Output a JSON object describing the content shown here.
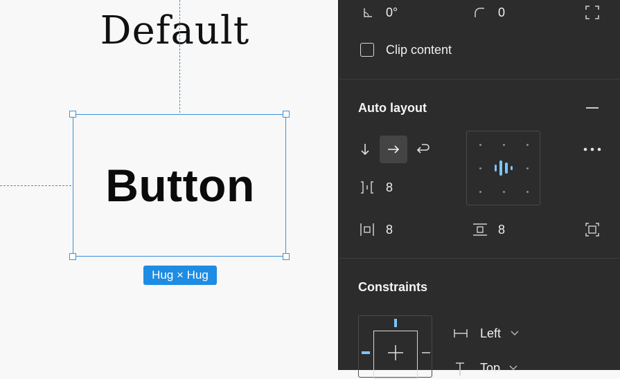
{
  "canvas": {
    "frame_title": "Default",
    "button_label": "Button",
    "size_badge": "Hug × Hug"
  },
  "panel": {
    "rotation": {
      "icon": "rotation-angle-icon",
      "value": "0°"
    },
    "corner_radius": {
      "icon": "corner-radius-icon",
      "value": "0"
    },
    "independent_corners_icon": "independent-corners-icon",
    "clip_content": {
      "label": "Clip content",
      "checked": false
    },
    "auto_layout": {
      "title": "Auto layout",
      "remove_icon": "minus-icon",
      "directions": [
        "down-arrow",
        "right-arrow",
        "wrap-arrow"
      ],
      "active_direction": "right-arrow",
      "gap": "8",
      "horizontal_padding": "8",
      "vertical_padding": "8",
      "alignment": "center-center",
      "accent": "#7cc4fa"
    },
    "constraints": {
      "title": "Constraints",
      "horizontal": "Left",
      "vertical": "Top"
    }
  }
}
